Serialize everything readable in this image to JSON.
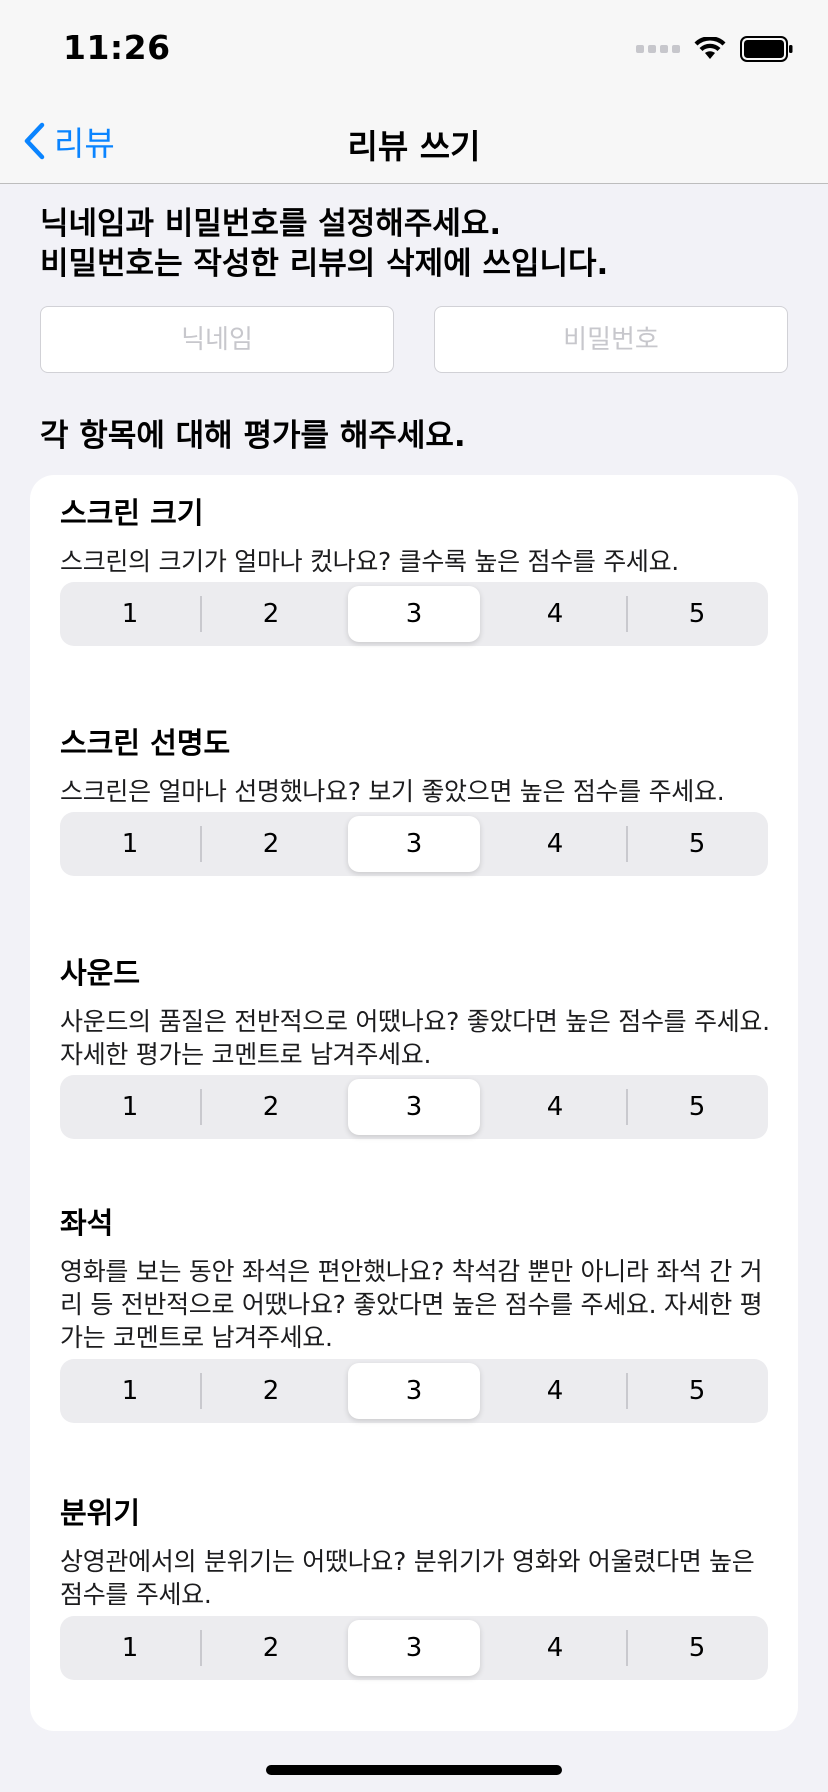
{
  "status_bar": {
    "time": "11:26"
  },
  "nav": {
    "back_label": "리뷰",
    "title": "리뷰 쓰기"
  },
  "intro": {
    "line1": "닉네임과 비밀번호를 설정해주세요.",
    "line2": "비밀번호는 작성한 리뷰의 삭제에 쓰입니다."
  },
  "fields": {
    "nickname_placeholder": "닉네임",
    "password_placeholder": "비밀번호"
  },
  "rating_section_title": "각 항목에 대해 평가를 해주세요.",
  "criteria": [
    {
      "title": "스크린 크기",
      "desc": "스크린의 크기가 얼마나 컸나요? 클수록 높은 점수를 주세요.",
      "options": [
        "1",
        "2",
        "3",
        "4",
        "5"
      ],
      "selected": "3"
    },
    {
      "title": "스크린 선명도",
      "desc": "스크린은 얼마나 선명했나요? 보기 좋았으면 높은 점수를 주세요.",
      "options": [
        "1",
        "2",
        "3",
        "4",
        "5"
      ],
      "selected": "3"
    },
    {
      "title": "사운드",
      "desc": "사운드의 품질은 전반적으로 어땠나요? 좋았다면 높은 점수를 주세요. 자세한 평가는 코멘트로 남겨주세요.",
      "options": [
        "1",
        "2",
        "3",
        "4",
        "5"
      ],
      "selected": "3"
    },
    {
      "title": "좌석",
      "desc": "영화를 보는 동안 좌석은 편안했나요? 착석감 뿐만 아니라 좌석 간 거리 등 전반적으로 어땠나요? 좋았다면 높은 점수를 주세요. 자세한 평가는 코멘트로 남겨주세요.",
      "options": [
        "1",
        "2",
        "3",
        "4",
        "5"
      ],
      "selected": "3"
    },
    {
      "title": "분위기",
      "desc": "상영관에서의 분위기는 어땠나요? 분위기가 영화와 어울렸다면 높은 점수를 주세요.",
      "options": [
        "1",
        "2",
        "3",
        "4",
        "5"
      ],
      "selected": "3"
    }
  ],
  "colors": {
    "accent": "#0a84ff",
    "background": "#f2f2f7",
    "segment_bg": "#ececef"
  }
}
